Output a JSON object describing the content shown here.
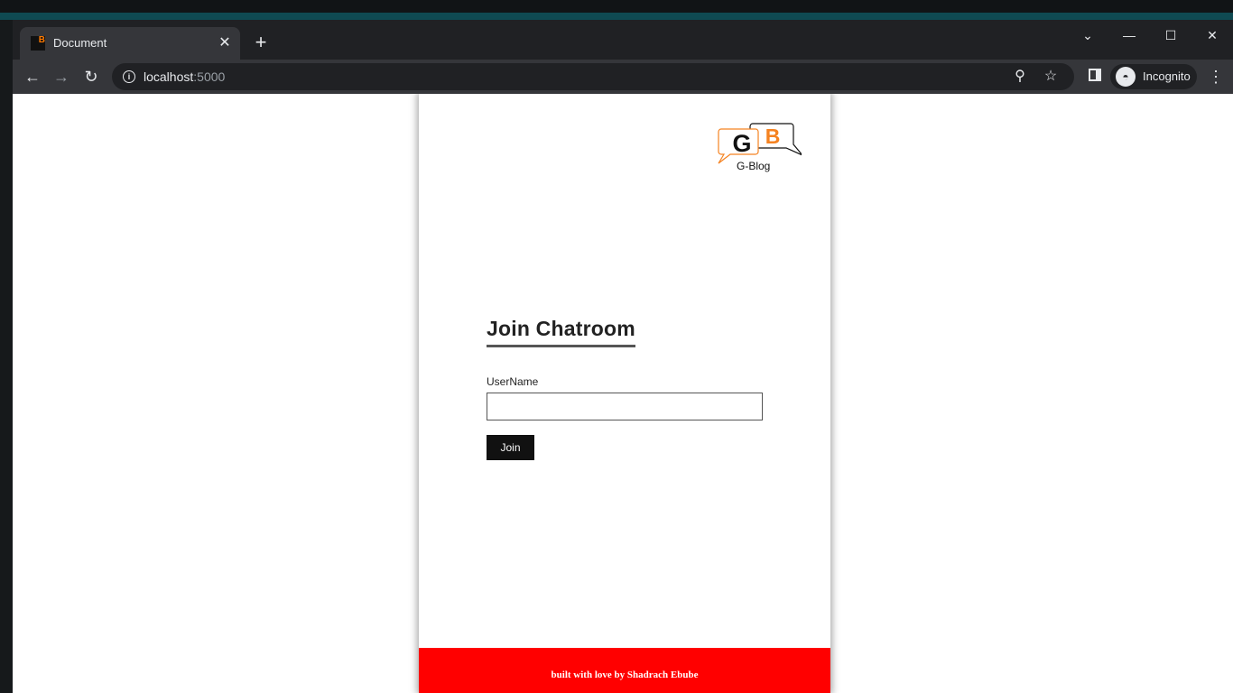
{
  "browser": {
    "tab": {
      "title": "Document",
      "favicon_letter": "B"
    },
    "address": {
      "host": "localhost",
      "port": ":5000"
    },
    "profile_label": "Incognito",
    "icons": {
      "back": "arrow-left-icon",
      "forward": "arrow-right-icon",
      "reload": "reload-icon",
      "info": "info-icon",
      "zoom": "zoom-out-icon",
      "bookmark": "star-icon",
      "side_panel": "side-panel-icon",
      "menu": "kebab-menu-icon",
      "tab_search": "chevron-down-icon",
      "minimize": "minimize-icon",
      "maximize": "maximize-icon",
      "close": "close-icon"
    }
  },
  "page": {
    "logo": {
      "letters": [
        "G",
        "B"
      ],
      "caption": "G-Blog",
      "accent_color": "#f58220"
    },
    "heading": "Join Chatroom",
    "form": {
      "username_label": "UserName",
      "username_value": "",
      "submit_label": "Join"
    },
    "footer": {
      "text": "built with love by Shadrach Ebube",
      "color": "#ff0000"
    }
  }
}
